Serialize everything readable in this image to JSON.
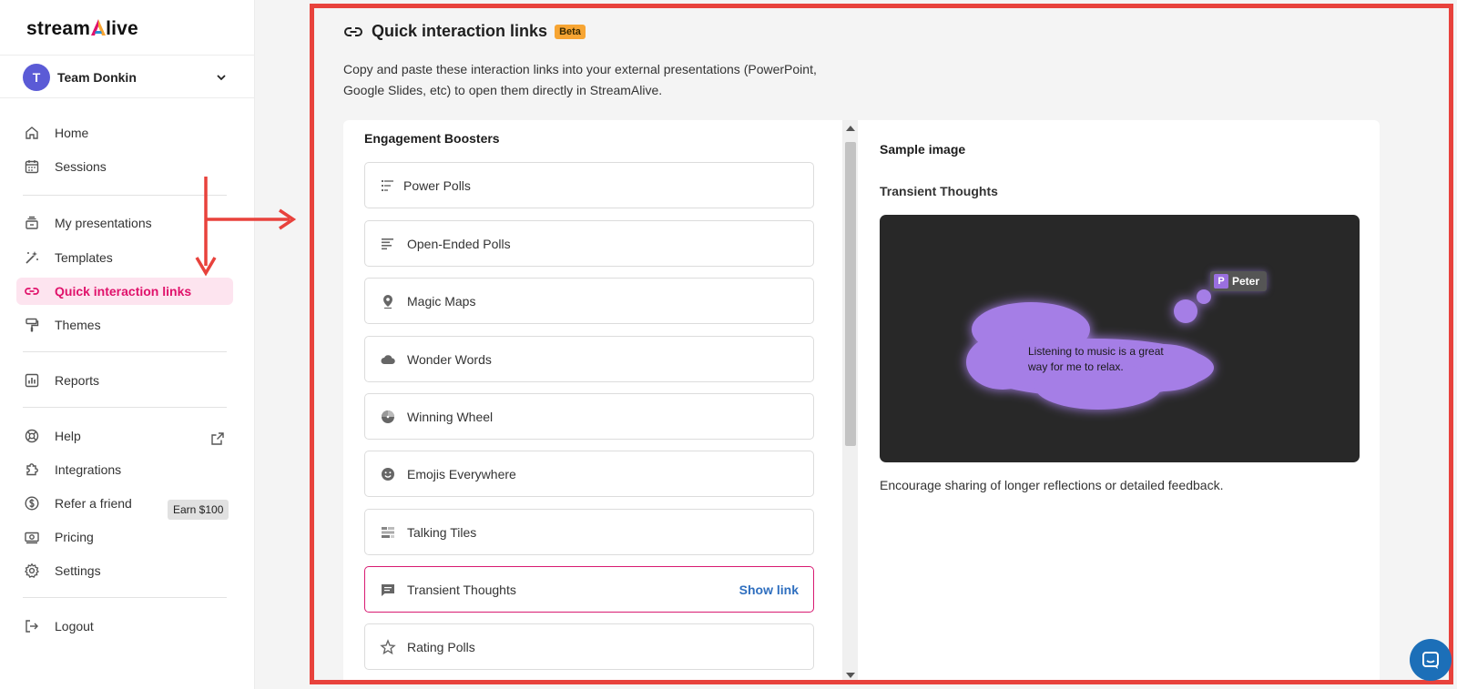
{
  "brand": {
    "logo_text_left": "stream",
    "logo_text_right": "live"
  },
  "team": {
    "avatar_letter": "T",
    "name": "Team Donkin"
  },
  "sidebar": {
    "items": [
      {
        "label": "Home"
      },
      {
        "label": "Sessions"
      },
      {
        "label": "My presentations"
      },
      {
        "label": "Templates"
      },
      {
        "label": "Quick interaction links"
      },
      {
        "label": "Themes"
      },
      {
        "label": "Reports"
      },
      {
        "label": "Help"
      },
      {
        "label": "Integrations"
      },
      {
        "label": "Refer a friend"
      },
      {
        "label": "Pricing"
      },
      {
        "label": "Settings"
      },
      {
        "label": "Logout"
      }
    ],
    "earn_badge": "Earn $100"
  },
  "main": {
    "title": "Quick interaction links",
    "beta_badge": "Beta",
    "description": "Copy and paste these interaction links into your external presentations (PowerPoint, Google Slides, etc) to open them directly in StreamAlive.",
    "list": {
      "header": "Engagement Boosters",
      "items": [
        {
          "label": "Power Polls"
        },
        {
          "label": "Open-Ended Polls"
        },
        {
          "label": "Magic Maps"
        },
        {
          "label": "Wonder Words"
        },
        {
          "label": "Winning Wheel"
        },
        {
          "label": "Emojis Everywhere"
        },
        {
          "label": "Talking Tiles"
        },
        {
          "label": "Transient Thoughts"
        },
        {
          "label": "Rating Polls"
        }
      ],
      "show_link_label": "Show link"
    },
    "preview": {
      "heading": "Sample image",
      "subheading": "Transient Thoughts",
      "cloud_text": "Listening to music is a great way for me to relax.",
      "user_initial": "P",
      "user_name": "Peter",
      "caption": "Encourage sharing of longer reflections or detailed feedback."
    }
  },
  "colors": {
    "accent": "#e0126b",
    "active_bg": "#fde4ef",
    "annotation": "#e8423c",
    "beta": "#f7a533",
    "link": "#2f6fbf",
    "cloud": "#a57ee6"
  }
}
